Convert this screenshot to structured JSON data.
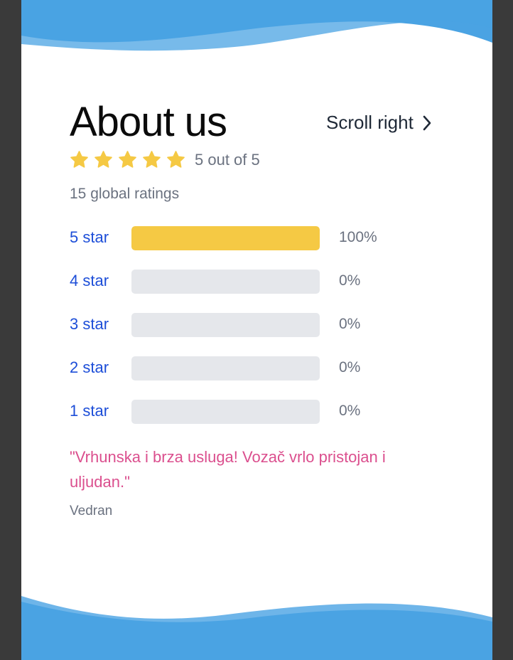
{
  "about": {
    "title": "About us",
    "scroll_label": "Scroll right"
  },
  "rating": {
    "stars": 5,
    "text": "5 out of 5",
    "global": "15 global ratings",
    "star_color": "#f5c944"
  },
  "histogram": [
    {
      "label": "5 star",
      "percent": "100%",
      "fill": 1.0
    },
    {
      "label": "4 star",
      "percent": "0%",
      "fill": 0
    },
    {
      "label": "3 star",
      "percent": "0%",
      "fill": 0
    },
    {
      "label": "2 star",
      "percent": "0%",
      "fill": 0
    },
    {
      "label": "1 star",
      "percent": "0%",
      "fill": 0
    }
  ],
  "review": {
    "quote": "\"Vrhunska i brza usluga! Vozač vrlo pristojan i uljudan.\"",
    "author": "Vedran"
  },
  "colors": {
    "wave": "#4aa3e3",
    "link": "#1d4ed8",
    "quote": "#db4f8e",
    "bar_fill": "#f5c944",
    "bar_track": "#e5e7eb"
  }
}
